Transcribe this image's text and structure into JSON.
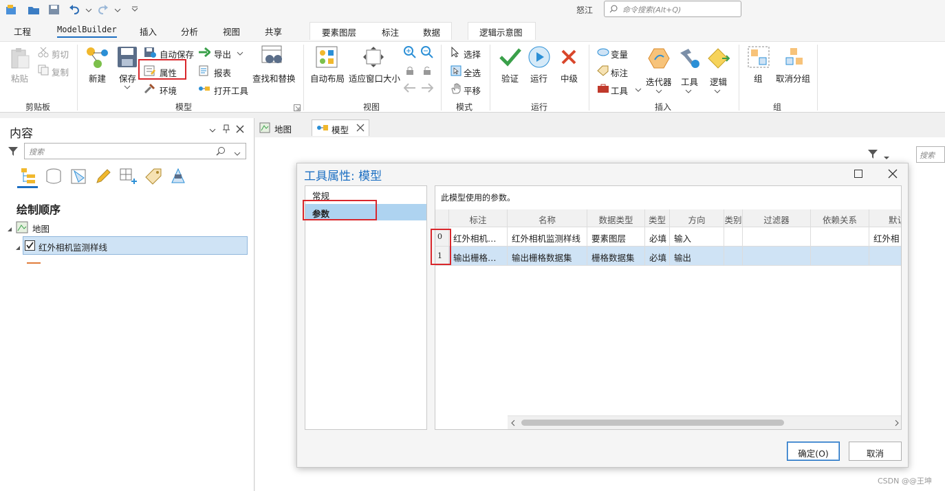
{
  "titlebar": {
    "user": "怒江",
    "command_search_placeholder": "命令搜索(Alt+Q)"
  },
  "tabs": {
    "main": [
      "工程",
      "ModelBuilder",
      "插入",
      "分析",
      "视图",
      "共享"
    ],
    "active_index": 1,
    "context_group1": [
      "要素图层",
      "标注",
      "数据"
    ],
    "context_group2": [
      "逻辑示意图"
    ]
  },
  "ribbon": {
    "clipboard": {
      "paste": "粘贴",
      "cut": "剪切",
      "copy": "复制",
      "label": "剪贴板"
    },
    "model": {
      "new": "新建",
      "save": "保存",
      "autosave": "自动保存",
      "properties": "属性",
      "environments": "环境",
      "export": "导出",
      "report": "报表",
      "open_tool": "打开工具",
      "find_replace": "查找和替换",
      "label": "模型"
    },
    "view": {
      "auto_layout": "自动布局",
      "fit_window": "适应窗口大小",
      "label": "视图"
    },
    "mode": {
      "select": "选择",
      "select_all": "全选",
      "pan": "平移",
      "label": "模式"
    },
    "run": {
      "validate": "验证",
      "run": "运行",
      "stop": "中级",
      "label": "运行"
    },
    "insert": {
      "variable": "变量",
      "label_btn": "标注",
      "tools": "工具",
      "iterators": "迭代器",
      "tool": "工具",
      "logic": "逻辑",
      "label": "插入"
    },
    "group": {
      "group": "组",
      "ungroup": "取消分组",
      "label": "组"
    }
  },
  "contents": {
    "title": "内容",
    "search_placeholder": "搜索",
    "section": "绘制顺序",
    "map_item": "地图",
    "layer_item": "红外相机监测样线"
  },
  "document_tabs": [
    {
      "label": "地图"
    },
    {
      "label": "模型"
    }
  ],
  "doc_search_placeholder": "搜索",
  "dialog": {
    "title": "工具属性: 模型",
    "nav": [
      "常规",
      "参数"
    ],
    "selected_nav": 1,
    "description": "此模型使用的参数。",
    "columns": [
      "标注",
      "名称",
      "数据类型",
      "类型",
      "方向",
      "类别",
      "过滤器",
      "依赖关系",
      "默认"
    ],
    "rows": [
      {
        "index": "0",
        "cells": [
          "红外相机…",
          "红外相机监测样线",
          "要素图层",
          "必填",
          "输入",
          "",
          "",
          "",
          "红外相"
        ]
      },
      {
        "index": "1",
        "cells": [
          "输出栅格…",
          "输出栅格数据集",
          "栅格数据集",
          "必填",
          "输出",
          "",
          "",
          "",
          ""
        ]
      }
    ],
    "selected_row": 1,
    "ok": "确定(O)",
    "cancel": "取消"
  },
  "watermark": "CSDN @@王坤",
  "colors": {
    "accent": "#1b6ec2",
    "highlight": "#d9262b",
    "selection": "#cfe3f5"
  }
}
